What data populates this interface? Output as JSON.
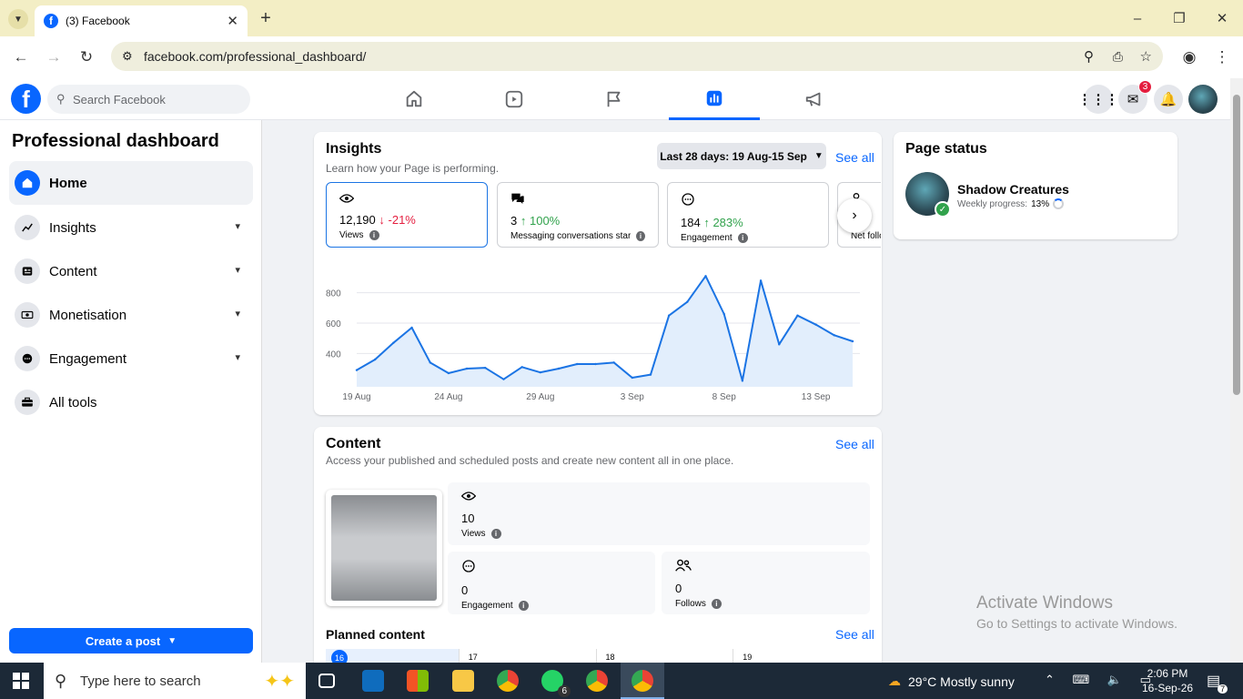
{
  "browser": {
    "tab_title": "(3) Facebook",
    "url": "facebook.com/professional_dashboard/"
  },
  "fb": {
    "search_placeholder": "Search Facebook",
    "messenger_badge": "3"
  },
  "sidebar": {
    "title": "Professional dashboard",
    "items": [
      {
        "label": "Home"
      },
      {
        "label": "Insights"
      },
      {
        "label": "Content"
      },
      {
        "label": "Monetisation"
      },
      {
        "label": "Engagement"
      },
      {
        "label": "All tools"
      }
    ],
    "create_post": "Create a post"
  },
  "insights": {
    "title": "Insights",
    "subtitle": "Learn how your Page is performing.",
    "date_range": "Last 28 days: 19 Aug-15 Sep",
    "see_all": "See all",
    "metrics": [
      {
        "value": "12,190",
        "change": "-21%",
        "direction": "down",
        "label": "Views"
      },
      {
        "value": "3",
        "change": "100%",
        "direction": "up",
        "label": "Messaging conversations started"
      },
      {
        "value": "184",
        "change": "283%",
        "direction": "up",
        "label": "Engagement"
      },
      {
        "value": "",
        "change": "",
        "direction": "down",
        "label": "Net follows"
      }
    ]
  },
  "chart_data": {
    "type": "area",
    "yticks": [
      400,
      600,
      800
    ],
    "ylim": [
      180,
      960
    ],
    "xticks": [
      "19 Aug",
      "24 Aug",
      "29 Aug",
      "3 Sep",
      "8 Sep",
      "13 Sep"
    ],
    "x": [
      "19 Aug",
      "20 Aug",
      "21 Aug",
      "22 Aug",
      "23 Aug",
      "24 Aug",
      "25 Aug",
      "26 Aug",
      "27 Aug",
      "28 Aug",
      "29 Aug",
      "30 Aug",
      "31 Aug",
      "1 Sep",
      "2 Sep",
      "3 Sep",
      "4 Sep",
      "5 Sep",
      "6 Sep",
      "7 Sep",
      "8 Sep",
      "9 Sep",
      "10 Sep",
      "11 Sep",
      "12 Sep",
      "13 Sep",
      "14 Sep",
      "15 Sep"
    ],
    "values": [
      290,
      360,
      470,
      570,
      340,
      270,
      300,
      305,
      230,
      310,
      275,
      300,
      330,
      330,
      340,
      240,
      260,
      650,
      740,
      910,
      660,
      220,
      880,
      460,
      650,
      590,
      520,
      480
    ],
    "line_color": "#1b74e4",
    "fill_color": "#e2eefc",
    "grid": true
  },
  "content": {
    "title": "Content",
    "subtitle": "Access your published and scheduled posts and create new content all in one place.",
    "see_all": "See all",
    "views_value": "10",
    "views_label": "Views",
    "engagement_value": "0",
    "engagement_label": "Engagement",
    "follows_value": "0",
    "follows_label": "Follows",
    "planned_title": "Planned content",
    "planned_see_all": "See all",
    "days": [
      "16",
      "17",
      "18",
      "19"
    ]
  },
  "page_status": {
    "title": "Page status",
    "name": "Shadow Creatures",
    "progress_label": "Weekly progress:",
    "progress_value": "13%"
  },
  "watermark": {
    "line1": "Activate Windows",
    "line2": "Go to Settings to activate Windows."
  },
  "taskbar": {
    "search_placeholder": "Type here to search",
    "weather": "29°C  Mostly sunny",
    "time": "2:06 PM",
    "date": "16-Sep-26",
    "whatsapp_badge": "6",
    "notif_badge": "7"
  }
}
